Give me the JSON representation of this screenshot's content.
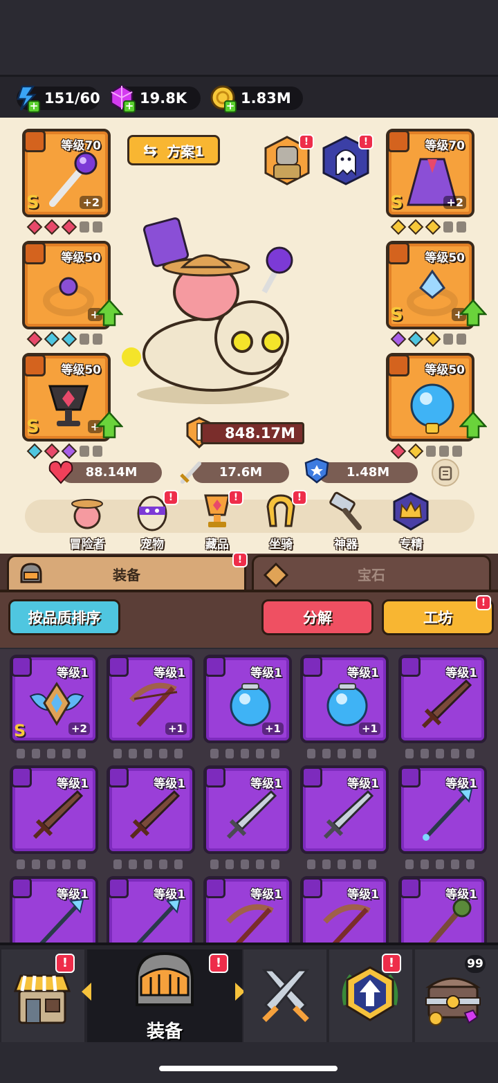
{
  "resources": [
    {
      "icon": "energy-icon",
      "value": "151/60"
    },
    {
      "icon": "gem-icon",
      "value": "19.8K"
    },
    {
      "icon": "gold-coin-icon",
      "value": "1.83M"
    }
  ],
  "plan": {
    "label": "方案1"
  },
  "equipped": {
    "weapon": {
      "level": "等级70",
      "rank": "S",
      "plus": "+2"
    },
    "armor": {
      "level": "等级70",
      "rank": "S",
      "plus": "+2"
    },
    "ring_left": {
      "level": "等级50",
      "plus": "+"
    },
    "ring_right": {
      "level": "等级50",
      "rank": "S",
      "plus": "+"
    },
    "trophy": {
      "level": "等级50",
      "rank": "S",
      "plus": "+"
    },
    "orb": {
      "level": "等级50"
    }
  },
  "power": "848.17M",
  "stats": {
    "hp": "88.14M",
    "attack": "17.6M",
    "defense": "1.48M"
  },
  "categories": [
    {
      "name": "cat-adventurer",
      "label": "冒险者"
    },
    {
      "name": "cat-pet",
      "label": "宠物"
    },
    {
      "name": "cat-collection",
      "label": "藏品"
    },
    {
      "name": "cat-mount",
      "label": "坐骑"
    },
    {
      "name": "cat-artifact",
      "label": "神器"
    },
    {
      "name": "cat-mastery",
      "label": "专精"
    }
  ],
  "tabs": {
    "equipment": "装备",
    "gems": "宝石"
  },
  "actions": {
    "sort": "按品质排序",
    "salvage": "分解",
    "workshop": "工坊"
  },
  "inventory_level": "等级1",
  "inventory_plus": {
    "p2": "+2",
    "p1": "+1"
  },
  "bottom_nav": {
    "equipment": "装备",
    "chest_count": "99"
  },
  "badge": "!",
  "colors": {
    "epic": "#9a3fd8",
    "legendary": "#f6a13c",
    "alert": "#ee2d4a"
  }
}
